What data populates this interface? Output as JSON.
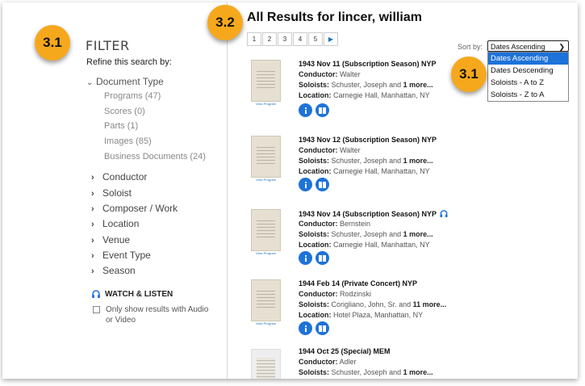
{
  "annotations": {
    "left_badge": "3.1",
    "title_badge": "3.2",
    "sort_badge": "3.1"
  },
  "filter": {
    "title": "FILTER",
    "refine": "Refine this search by:",
    "document_type": "Document Type",
    "doc_subitems": [
      "Programs (47)",
      "Scores (0)",
      "Parts (1)",
      "Images (85)",
      "Business Documents (24)"
    ],
    "facets": [
      "Conductor",
      "Soloist",
      "Composer / Work",
      "Location",
      "Venue",
      "Event Type",
      "Season"
    ],
    "watch_listen": "WATCH & LISTEN",
    "checkbox_label": "Only show results with Audio or Video"
  },
  "main": {
    "title": "All Results for lincer, william",
    "pages": [
      "1",
      "2",
      "3",
      "4",
      "5"
    ],
    "sort_label": "Sort by:",
    "sort_selected": "Dates Ascending",
    "sort_options": [
      "Dates Ascending",
      "Dates Descending",
      "Soloists - A to Z",
      "Soloists - Z to A"
    ]
  },
  "results": [
    {
      "title": "1943 Nov 11 (Subscription Season) NYP",
      "conductor": "Walter",
      "soloists": "Schuster, Joseph and ",
      "soloists_more": "1 more...",
      "location": "Carnegie Hall, Manhattan, NY",
      "thumb_caption": "View Program"
    },
    {
      "title": "1943 Nov 12 (Subscription Season) NYP",
      "conductor": "Walter",
      "soloists": "Schuster, Joseph and ",
      "soloists_more": "1 more...",
      "location": "Carnegie Hall, Manhattan, NY",
      "thumb_caption": "View Program"
    },
    {
      "title": "1943 Nov 14 (Subscription Season) NYP",
      "conductor": "Bernstein",
      "soloists": "Schuster, Joseph and ",
      "soloists_more": "1 more...",
      "location": "Carnegie Hall, Manhattan, NY",
      "thumb_caption": "View Program"
    },
    {
      "title": "1944 Feb 14 (Private Concert) NYP",
      "conductor": "Rodzinski",
      "soloists": "Corigliano, John, Sr. and ",
      "soloists_more": "11 more...",
      "location": "Hotel Plaza, Manhattan, NY",
      "thumb_caption": "View Program"
    },
    {
      "title": "1944 Oct 25 (Special) MEM",
      "conductor": "Adler",
      "soloists": "Schuster, Joseph and ",
      "soloists_more": "1 more..."
    }
  ],
  "labels": {
    "conductor": "Conductor:",
    "soloists": "Soloists:",
    "location": "Location:"
  },
  "colors": {
    "badge": "#f6a81d",
    "accent_blue": "#1e73d8"
  }
}
